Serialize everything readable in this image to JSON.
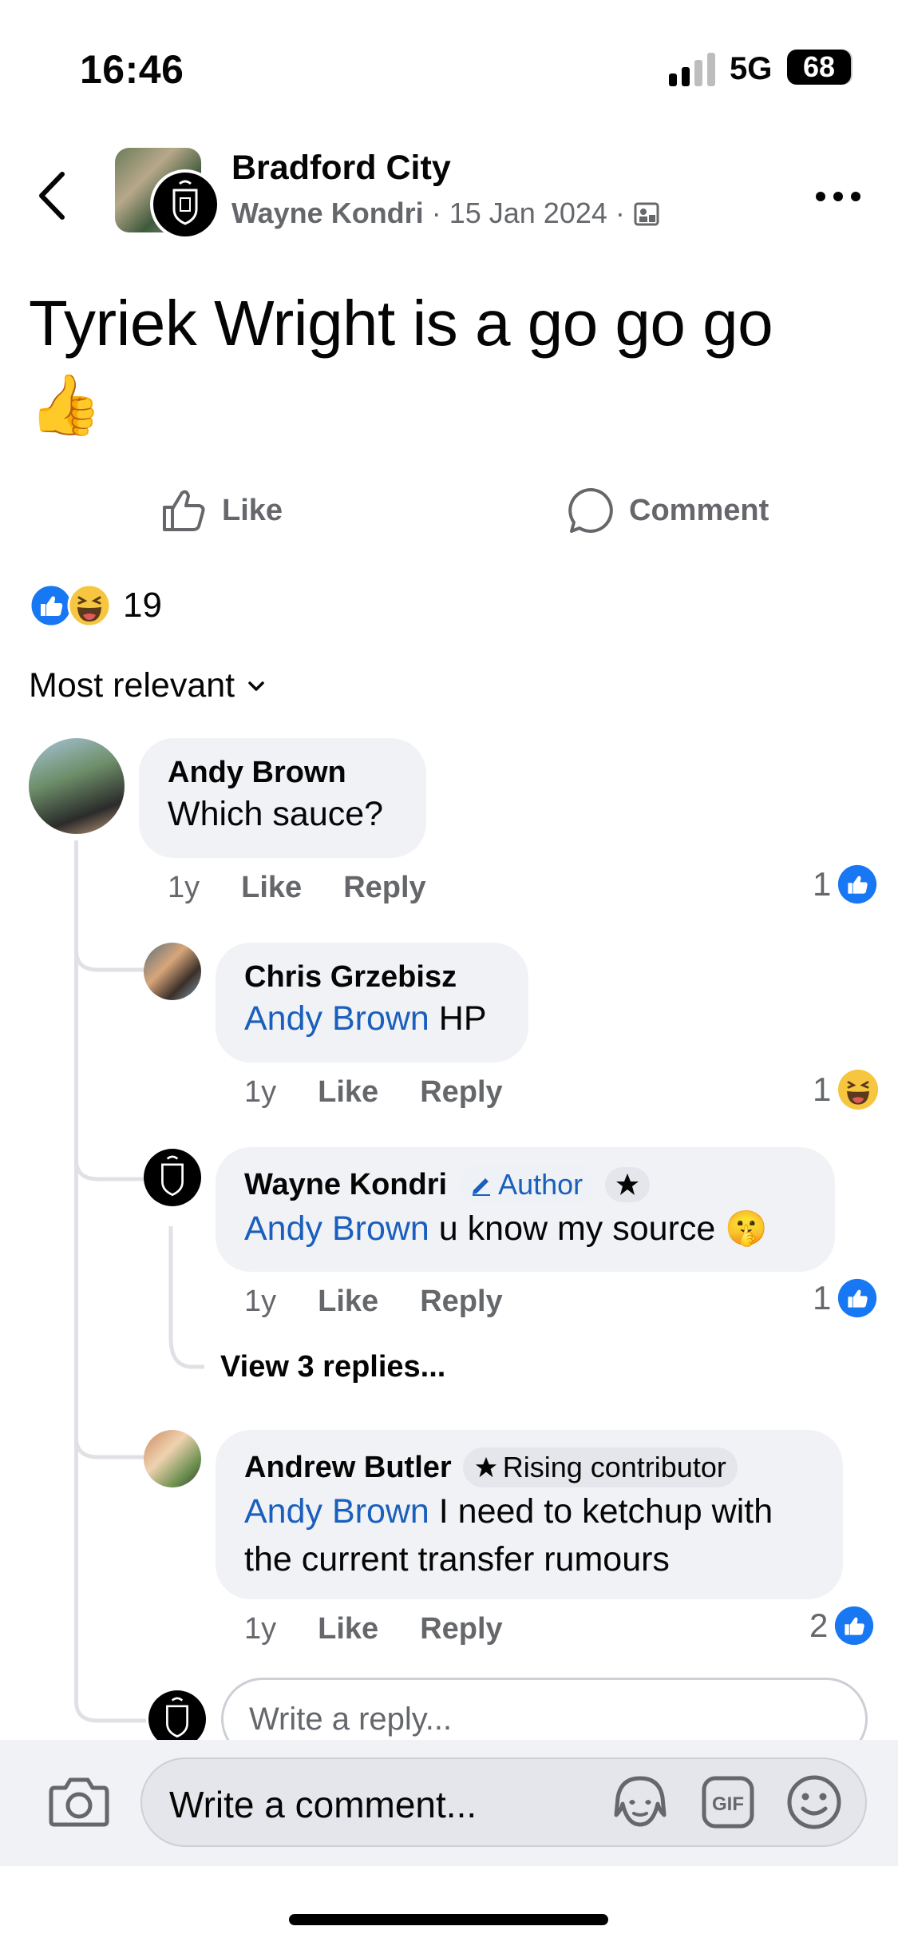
{
  "status": {
    "time": "16:46",
    "network": "5G",
    "battery": "68"
  },
  "header": {
    "group_name": "Bradford City",
    "author": "Wayne Kondri",
    "sep1": "·",
    "date": "15 Jan 2024",
    "sep2": "·"
  },
  "post": {
    "text": "Tyriek Wright is a go go go",
    "emoji": "👍"
  },
  "actions": {
    "like": "Like",
    "comment": "Comment"
  },
  "reactions": {
    "count": "19"
  },
  "sort": {
    "label": "Most relevant"
  },
  "comments": [
    {
      "name": "Andy Brown",
      "text": "Which sauce?",
      "time": "1y",
      "like": "Like",
      "reply": "Reply",
      "reaction_count": "1",
      "reaction": "like"
    },
    {
      "name": "Chris Grzebisz",
      "mention": "Andy Brown",
      "text": " HP",
      "time": "1y",
      "like": "Like",
      "reply": "Reply",
      "reaction_count": "1",
      "reaction": "haha"
    },
    {
      "name": "Wayne Kondri",
      "badge": "Author",
      "mention": "Andy Brown",
      "text": " u know my source 🤫",
      "time": "1y",
      "like": "Like",
      "reply": "Reply",
      "reaction_count": "1",
      "reaction": "like",
      "view_replies": "View 3 replies..."
    },
    {
      "name": "Andrew Butler",
      "badge": "Rising contributor",
      "mention": "Andy Brown",
      "text": " I need to ketchup with",
      "text2": "the current transfer rumours",
      "time": "1y",
      "like": "Like",
      "reply": "Reply",
      "reaction_count": "2",
      "reaction": "like"
    }
  ],
  "reply_box": {
    "placeholder": "Write a reply..."
  },
  "comment_box": {
    "placeholder": "Write a comment..."
  },
  "colors": {
    "accent": "#1877f2",
    "mention": "#1a5fbd",
    "bubble": "#f0f2f5"
  }
}
